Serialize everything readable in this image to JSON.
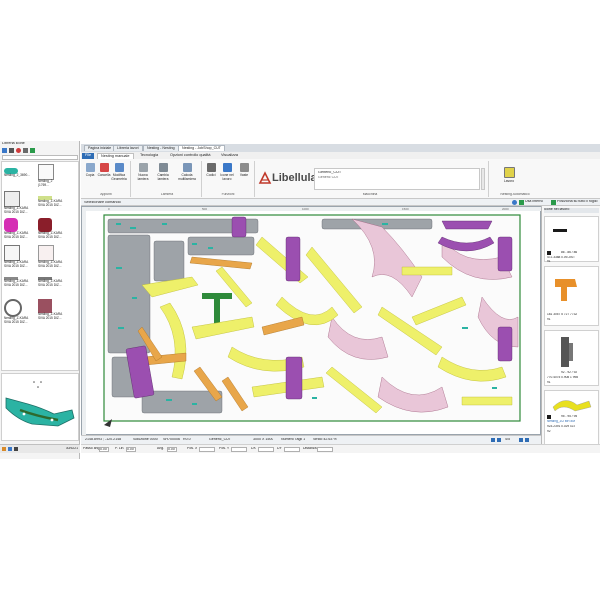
{
  "library": {
    "title": "Libreria icone",
    "items": [
      {
        "label": "Nesting_2_3690..."
      },
      {
        "label": "Nesting_2 (1769..."
      },
      {
        "label": "Nesting_Z-KARA SIVA 2015 DIZ..."
      },
      {
        "label": "Nesting_Z-KARA SIVA 2015 DIZ..."
      },
      {
        "label": "Nesting_Z-KARA SIVA 2015 DIZ..."
      },
      {
        "label": "Nesting_Z-KARA SIVA 2015 DIZ..."
      },
      {
        "label": "Nesting_Z-KARA SIVA 2015 DIZ..."
      },
      {
        "label": "Nesting_Z-KARA SIVA 2015 DIZ..."
      },
      {
        "label": "Nesting_Z-KARA SIVA 2015 DIZ..."
      },
      {
        "label": "Nesting_Z-KARA SIVA 2015 DIZ..."
      },
      {
        "label": "Nesting_Z-KARA SIVA 2015 DIZ..."
      },
      {
        "label": "Nesting_Z-KARA SIVA 2015 DIZ..."
      }
    ],
    "counter": "30/5221"
  },
  "doc_tabs": [
    "Pagina iniziale",
    "Libreria lavori",
    "Nesting - Nesting",
    "Nesting - JobShop_CUT"
  ],
  "ribbon_tabs": [
    "File",
    "Nesting manuale",
    "Tecnologia",
    "Opzioni controllo qualità",
    "Visualizza"
  ],
  "ribbon": {
    "buttons": [
      {
        "label": "Copia"
      },
      {
        "label": "Cancella"
      },
      {
        "label": "Modifica Geometria"
      },
      {
        "label": "Nuova lamiera"
      },
      {
        "label": "Cambia lamiera"
      },
      {
        "label": "Calcola multilamiera"
      },
      {
        "label": "Codici"
      },
      {
        "label": "Icone nel lavoro"
      },
      {
        "label": "Vaste"
      }
    ],
    "groups": [
      "Appunti",
      "Lamiera",
      "Funzioni",
      "Macchina",
      "Nesting Automatico"
    ],
    "brand": "Libellula",
    "machine_name": "Generic_CUT",
    "machine_sub": "Generic CUT",
    "lavoro_label": "Lavoro"
  },
  "command_bar": "Selezionare comando",
  "right_panel": {
    "toolbar": [
      "Usa interno",
      "Posiziona su tutto il foglio"
    ],
    "title": "Icone nel lavoro",
    "parts": [
      {
        "qty": "86 - 86 / 86",
        "code": "472.3388 0.09-JIST",
        "n": "91",
        "color": "#1a1a1a"
      },
      {
        "qty": "",
        "code": "181 3057 5 727 7732",
        "n": "91",
        "color": "#e8902a"
      },
      {
        "qty": "92 - 92 / 92",
        "code": "770.4075 0.908 1 998",
        "n": "91",
        "color": "#555555"
      },
      {
        "qty": "95 - 95 / 95",
        "code": "Nesting_ZU MR 8M",
        "n": "92",
        "color": "#e8e020"
      }
    ],
    "last_code": "923.2391 0.029 G/J"
  },
  "status": {
    "coords": "2148.8993 ; -120.2148",
    "solution": "Soluzione 0000",
    "sheet": "SH700006",
    "rot": "R0.0",
    "machine": "Generic_CUT",
    "size": "3000 X 1500",
    "cuts": "Numero Tagli 1",
    "waste": "Sfrido 42.63 %",
    "page": "4/5"
  },
  "fields": [
    {
      "label": "Passo ang.",
      "value": "0.00"
    },
    {
      "label": "P. Lin.",
      "value": "0.00"
    },
    {
      "label": "Ang.",
      "value": "0.00"
    },
    {
      "label": "Pos. X",
      "value": ""
    },
    {
      "label": "Pos. Y",
      "value": ""
    },
    {
      "label": "DX",
      "value": ""
    },
    {
      "label": "DY",
      "value": ""
    },
    {
      "label": "Distanza",
      "value": ""
    }
  ],
  "colors": {
    "yellow": "#eef06a",
    "purple": "#9b4fb0",
    "orange": "#e8a64a",
    "grey": "#9ea3a8",
    "pink": "#e9c6d8",
    "teal": "#2bb3a3",
    "green": "#2e8a3a"
  }
}
